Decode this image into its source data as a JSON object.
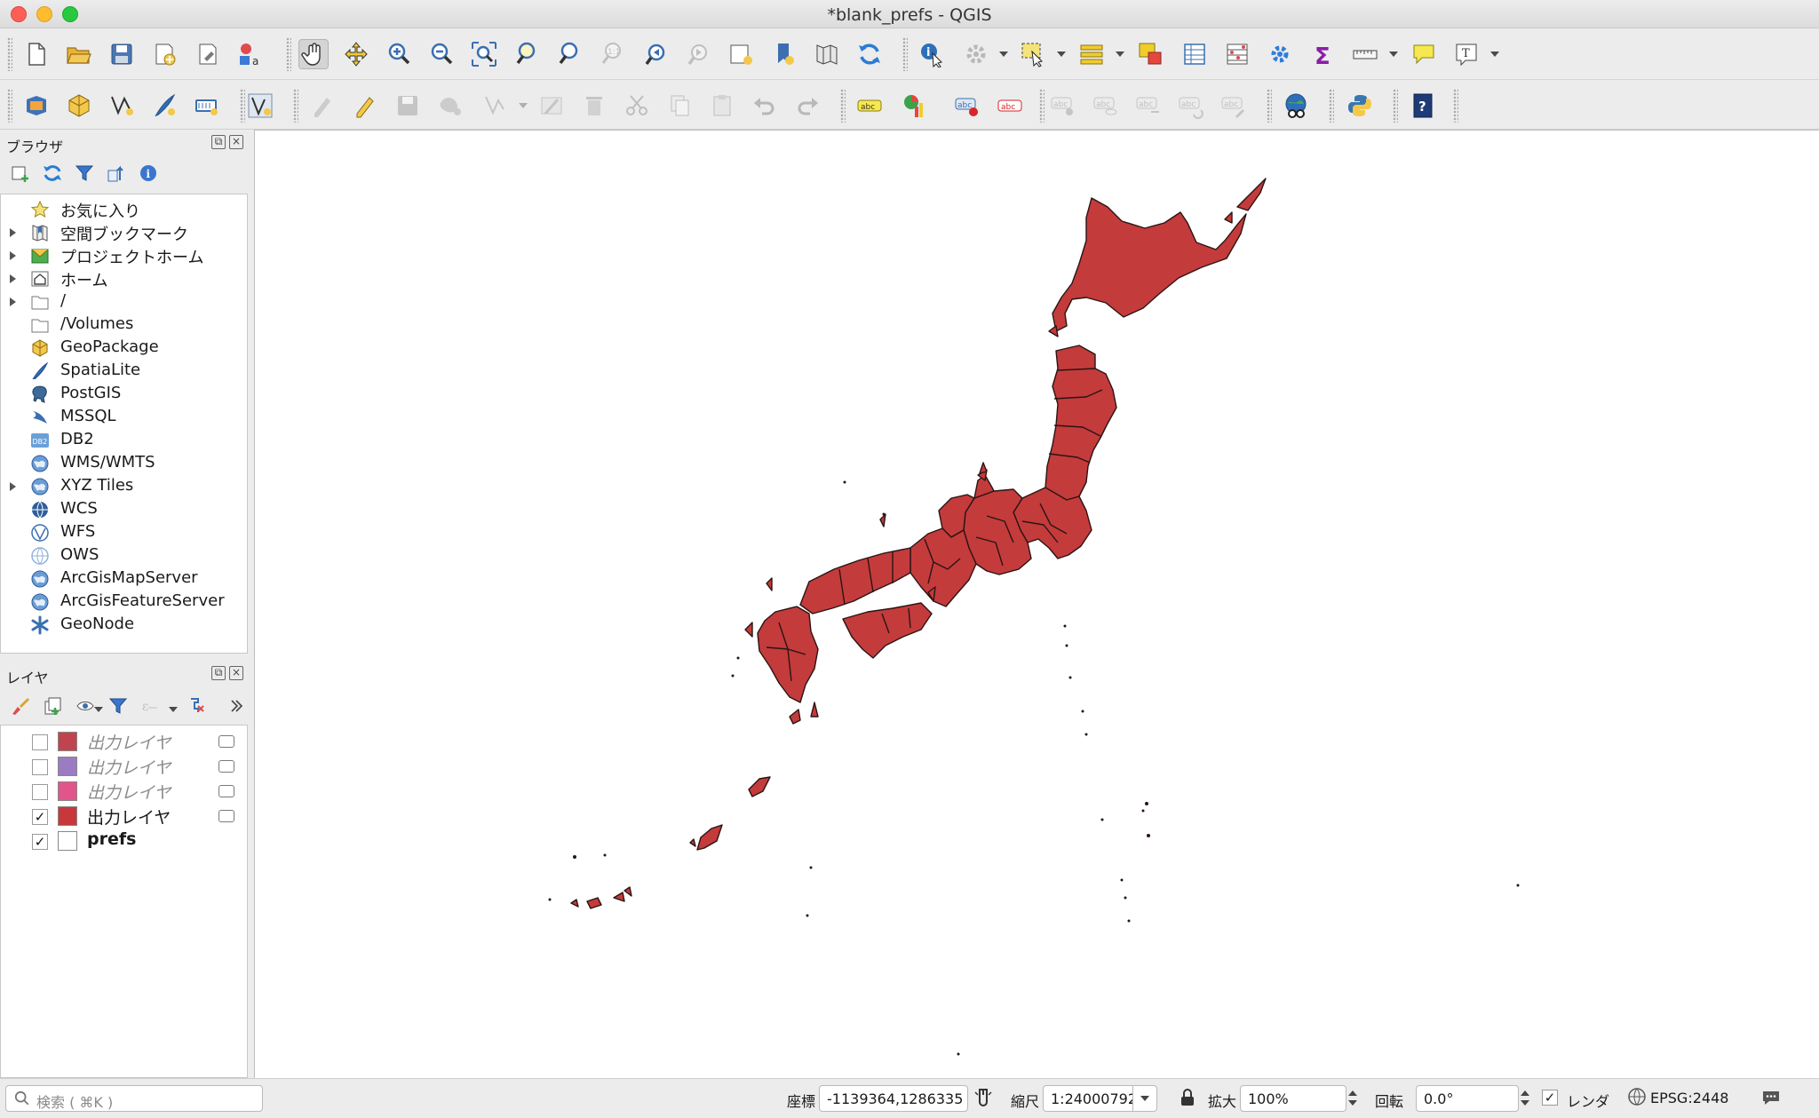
{
  "window": {
    "title": "*blank_prefs - QGIS",
    "traffic_colors": {
      "close": "#fe5f57",
      "minimize": "#febc2e",
      "zoom": "#28c840"
    }
  },
  "toolbar1": {
    "tools": [
      "new-project-icon",
      "open-project-icon",
      "save-project-icon",
      "new-print-layout-icon",
      "layout-manager-icon",
      "style-manager-icon",
      "pan-map-icon",
      "pan-to-selection-icon",
      "zoom-in-icon",
      "zoom-out-icon",
      "zoom-full-icon",
      "zoom-to-selection-icon",
      "zoom-to-layer-icon",
      "zoom-native-icon",
      "zoom-last-icon",
      "zoom-next-icon",
      "new-map-view-icon",
      "new-bookmark-icon",
      "show-bookmarks-icon",
      "refresh-icon",
      "identify-icon",
      "run-action-icon",
      "select-features-icon",
      "select-by-value-icon",
      "deselect-icon",
      "attribute-table-icon",
      "statistics-icon",
      "toolbox-icon",
      "field-calculator-icon",
      "measure-icon",
      "map-tips-icon",
      "text-annotation-icon"
    ]
  },
  "toolbar2": {
    "tools": [
      "data-source-manager-icon",
      "new-geopackage-layer-icon",
      "digitize-icon",
      "new-spatialite-layer-icon",
      "new-temp-layer-icon",
      "vertex-tool-icon",
      "current-edits-icon",
      "toggle-editing-icon",
      "save-edits-icon",
      "add-feature-icon",
      "vertex-edit-icon",
      "modify-attributes-icon",
      "delete-selected-icon",
      "cut-features-icon",
      "copy-features-icon",
      "paste-features-icon",
      "undo-icon",
      "redo-icon",
      "label-tool-icon",
      "diagram-tool-icon",
      "highlight-labels-icon",
      "pin-labels-icon",
      "show-hide-labels-icon",
      "move-label-icon",
      "rotate-label-icon",
      "change-label-icon",
      "plugin-globe-icon",
      "python-console-icon",
      "help-icon"
    ]
  },
  "browser_panel": {
    "title": "ブラウザ",
    "tools": [
      "add-selected-layers-icon",
      "refresh-icon",
      "filter-browser-icon",
      "collapse-all-icon",
      "enable-properties-icon"
    ],
    "items": [
      {
        "label": "お気に入り",
        "icon": "star-icon",
        "expandable": false
      },
      {
        "label": "空間ブックマーク",
        "icon": "bookmark-icon",
        "expandable": true
      },
      {
        "label": "プロジェクトホーム",
        "icon": "project-home-icon",
        "expandable": true
      },
      {
        "label": "ホーム",
        "icon": "home-icon",
        "expandable": true
      },
      {
        "label": "/",
        "icon": "folder-icon",
        "expandable": true
      },
      {
        "label": "/Volumes",
        "icon": "folder-icon",
        "expandable": false
      },
      {
        "label": "GeoPackage",
        "icon": "geopackage-icon",
        "expandable": false
      },
      {
        "label": "SpatiaLite",
        "icon": "spatialite-icon",
        "expandable": false
      },
      {
        "label": "PostGIS",
        "icon": "postgis-icon",
        "expandable": false
      },
      {
        "label": "MSSQL",
        "icon": "mssql-icon",
        "expandable": false
      },
      {
        "label": "DB2",
        "icon": "db2-icon",
        "expandable": false
      },
      {
        "label": "WMS/WMTS",
        "icon": "wms-globe-icon",
        "expandable": false
      },
      {
        "label": "XYZ Tiles",
        "icon": "xyz-globe-icon",
        "expandable": true
      },
      {
        "label": "WCS",
        "icon": "wcs-globe-icon",
        "expandable": false
      },
      {
        "label": "WFS",
        "icon": "wfs-globe-icon",
        "expandable": false
      },
      {
        "label": "OWS",
        "icon": "ows-globe-icon",
        "expandable": false
      },
      {
        "label": "ArcGisMapServer",
        "icon": "arcgis-map-icon",
        "expandable": false
      },
      {
        "label": "ArcGisFeatureServer",
        "icon": "arcgis-feature-icon",
        "expandable": false
      },
      {
        "label": "GeoNode",
        "icon": "geonode-icon",
        "expandable": false
      }
    ]
  },
  "layers_panel": {
    "title": "レイヤ",
    "tools": [
      "style-panel-icon",
      "add-group-icon",
      "manage-visibility-icon",
      "filter-legend-icon",
      "filter-expression-icon",
      "remove-layer-icon",
      "expand-all-icon"
    ],
    "layers": [
      {
        "name": "出力レイヤ",
        "checked": false,
        "checkmark": "",
        "color": "#c0444e",
        "style": "temp",
        "memory": true
      },
      {
        "name": "出力レイヤ",
        "checked": false,
        "checkmark": "",
        "color": "#9b7cc2",
        "style": "temp",
        "memory": true
      },
      {
        "name": "出力レイヤ",
        "checked": false,
        "checkmark": "",
        "color": "#e2558b",
        "style": "temp",
        "memory": true
      },
      {
        "name": "出力レイヤ",
        "checked": true,
        "checkmark": "✓",
        "color": "#c8383b",
        "style": "normal",
        "memory": true
      },
      {
        "name": "prefs",
        "checked": true,
        "checkmark": "✓",
        "color": "#ffffff",
        "style": "bold",
        "memory": false
      }
    ]
  },
  "map": {
    "fill_color": "#c43b3b",
    "stroke_color": "#2a1414"
  },
  "statusbar": {
    "search_placeholder": "検索 ( ⌘K )",
    "coordinate_label": "座標",
    "coordinate_value": "-1139364,1286335",
    "scale_label": "縮尺",
    "scale_value": "1:24000792",
    "magnifier_label": "拡大",
    "magnifier_value": "100%",
    "rotation_label": "回転",
    "rotation_value": "0.0°",
    "render_label": "レンダ",
    "render_checked": true,
    "render_checkmark": "✓",
    "crs_label": "EPSG:2448"
  }
}
